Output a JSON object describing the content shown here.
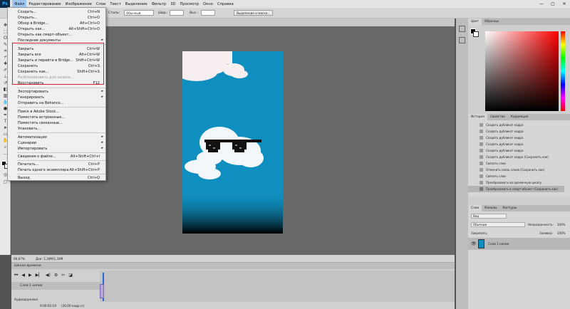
{
  "app": {
    "logo": "Ps"
  },
  "menubar": {
    "items": [
      "Файл",
      "Редактирование",
      "Изображение",
      "Слои",
      "Текст",
      "Выделение",
      "Фильтр",
      "3D",
      "Просмотр",
      "Окно",
      "Справка"
    ],
    "window_controls": [
      "—",
      "▢",
      "✕"
    ]
  },
  "optbar": {
    "style_label": "Стиль:",
    "style_value": "Обычный",
    "w_label": "Шир.:",
    "h_label": "Выс.:",
    "mask_button": "Выделение и маска..."
  },
  "file_menu": {
    "items": [
      {
        "label": "Создать...",
        "shortcut": "Ctrl+N"
      },
      {
        "label": "Открыть...",
        "shortcut": "Ctrl+O"
      },
      {
        "label": "Обзор в Bridge...",
        "shortcut": "Alt+Ctrl+O"
      },
      {
        "label": "Открыть как...",
        "shortcut": "Alt+Shift+Ctrl+O"
      },
      {
        "label": "Открыть как смарт-объект...",
        "shortcut": ""
      },
      {
        "label": "Последние документы",
        "shortcut": "",
        "submenu": true
      },
      {
        "label": "Закрыть",
        "shortcut": "Ctrl+W"
      },
      {
        "label": "Закрыть все",
        "shortcut": "Alt+Ctrl+W"
      },
      {
        "label": "Закрыть и перейти в Bridge...",
        "shortcut": "Shift+Ctrl+W"
      },
      {
        "label": "Сохранить",
        "shortcut": "Ctrl+S"
      },
      {
        "label": "Сохранить как...",
        "shortcut": "Shift+Ctrl+S"
      },
      {
        "label": "Разблокировать для записи...",
        "shortcut": "",
        "disabled": true
      },
      {
        "label": "Восстановить",
        "shortcut": "F12"
      },
      {
        "label": "Экспортировать",
        "shortcut": "",
        "submenu": true
      },
      {
        "label": "Генерировать",
        "shortcut": "",
        "submenu": true
      },
      {
        "label": "Отправить на Behance...",
        "shortcut": ""
      },
      {
        "label": "Поиск в Adobe Stock...",
        "shortcut": ""
      },
      {
        "label": "Поместить встроенные...",
        "shortcut": ""
      },
      {
        "label": "Поместить связанные...",
        "shortcut": ""
      },
      {
        "label": "Упаковать...",
        "shortcut": ""
      },
      {
        "label": "Автоматизация",
        "shortcut": "",
        "submenu": true
      },
      {
        "label": "Сценарии",
        "shortcut": "",
        "submenu": true
      },
      {
        "label": "Импортировать",
        "shortcut": "",
        "submenu": true
      },
      {
        "label": "Сведения о файле...",
        "shortcut": "Alt+Shift+Ctrl+I"
      },
      {
        "label": "Печатать...",
        "shortcut": "Ctrl+P"
      },
      {
        "label": "Печать одного экземпляра",
        "shortcut": "Alt+Shift+Ctrl+P"
      },
      {
        "label": "Выход",
        "shortcut": "Ctrl+Q"
      }
    ]
  },
  "status": {
    "zoom": "66,67%",
    "doc": "Док: 1,34М/1,34М"
  },
  "timeline": {
    "title": "Шкала времени",
    "layer": "Слой 1 копия",
    "audio": "Аудиодорожка",
    "timecode": "0:00:02:19",
    "fps": "(30,00 кадр./с)"
  },
  "color_panel": {
    "tabs": [
      "Цвет",
      "Образцы"
    ]
  },
  "history_panel": {
    "tabs": [
      "История",
      "Свойства",
      "Коррекция"
    ],
    "items": [
      "Создать дубликат кадра",
      "Создать дубликат кадра",
      "Создать дубликат кадра",
      "Создать дубликат кадра",
      "Создать дубликат кадра",
      "Создать дубликат кадра (Сохранить как)",
      "Связать слои",
      "Отменить связь слоев (Сохранить как)",
      "Связать слои",
      "Преобразовать во временную шкалу",
      "Преобразовать в смарт-объект (Сохранить как)"
    ]
  },
  "layers_panel": {
    "tabs": [
      "Слои",
      "Каналы",
      "Контуры"
    ],
    "filter": "Вид",
    "blend": "Обычные",
    "opacity_label": "Непрозрачность:",
    "opacity": "100%",
    "lock_label": "Закрепить:",
    "fill_label": "Заливка:",
    "fill": "100%",
    "layer_name": "Слой 1 копия"
  },
  "colors": {
    "accent_red": "#d4232b",
    "canvas_blue": "#0f8fbf"
  }
}
